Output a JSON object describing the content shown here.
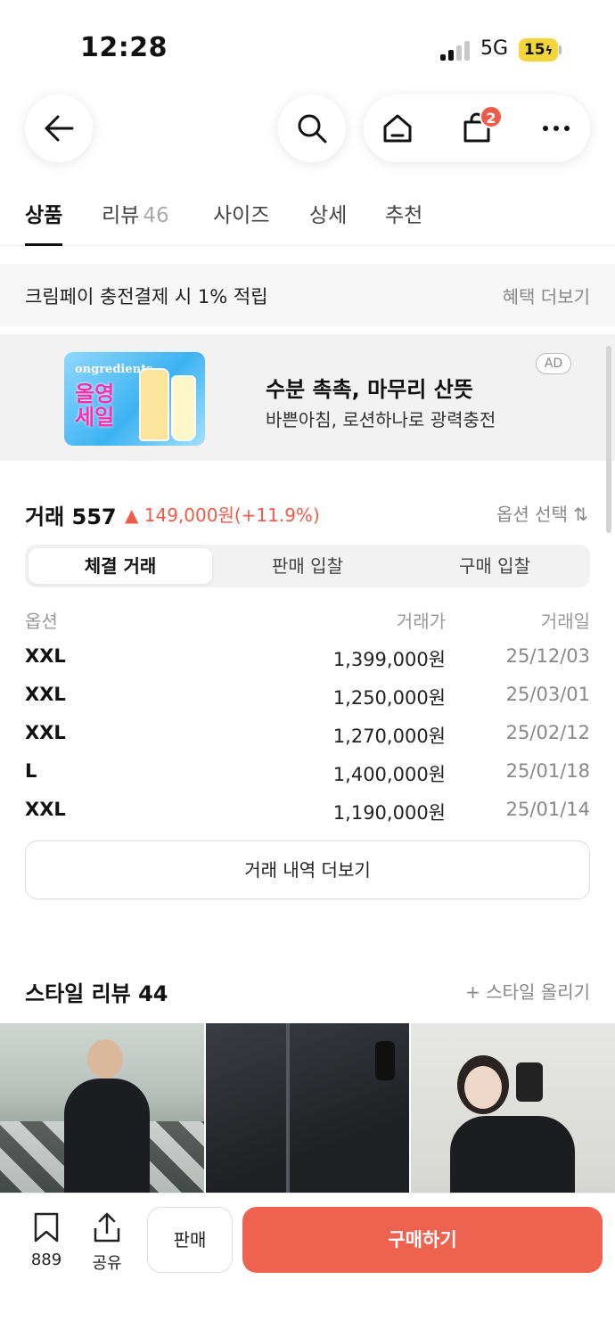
{
  "status_bar": {
    "time": "12:28",
    "network": "5G",
    "battery": "15"
  },
  "nav": {
    "cart_count": "2"
  },
  "tabs": [
    {
      "label": "상품",
      "count": ""
    },
    {
      "label": "리뷰",
      "count": "46"
    },
    {
      "label": "사이즈",
      "count": ""
    },
    {
      "label": "상세",
      "count": ""
    },
    {
      "label": "추천",
      "count": ""
    }
  ],
  "benefit": {
    "text": "크림페이 충전결제 시 1% 적립",
    "link": "혜택 더보기"
  },
  "ad": {
    "brand": "ongredients",
    "sale_text": "올영 세일",
    "title": "수분 촉촉, 마무리 산뜻",
    "subtitle": "바쁜아침, 로션하나로 광력충전",
    "badge": "AD"
  },
  "trade": {
    "header": "거래 557",
    "change": "▲ 149,000원(+11.9%)",
    "option_select": "옵션 선택 ⇅",
    "segments": [
      "체결 거래",
      "판매 입찰",
      "구매 입찰"
    ],
    "columns": [
      "옵션",
      "거래가",
      "거래일"
    ],
    "rows": [
      {
        "option": "XXL",
        "price": "1,399,000원",
        "date": "25/12/03"
      },
      {
        "option": "XXL",
        "price": "1,250,000원",
        "date": "25/03/01"
      },
      {
        "option": "XXL",
        "price": "1,270,000원",
        "date": "25/02/12"
      },
      {
        "option": "L",
        "price": "1,400,000원",
        "date": "25/01/18"
      },
      {
        "option": "XXL",
        "price": "1,190,000원",
        "date": "25/01/14"
      }
    ],
    "more_label": "거래 내역 더보기"
  },
  "style_review": {
    "title": "스타일 리뷰 44",
    "upload_label": "+ 스타일 올리기"
  },
  "bottom_bar": {
    "bookmark_count": "889",
    "share_label": "공유",
    "sell_label": "판매",
    "buy_label": "구매하기"
  },
  "colors": {
    "accent": "#ef6250",
    "price_up": "#ef5b48"
  }
}
